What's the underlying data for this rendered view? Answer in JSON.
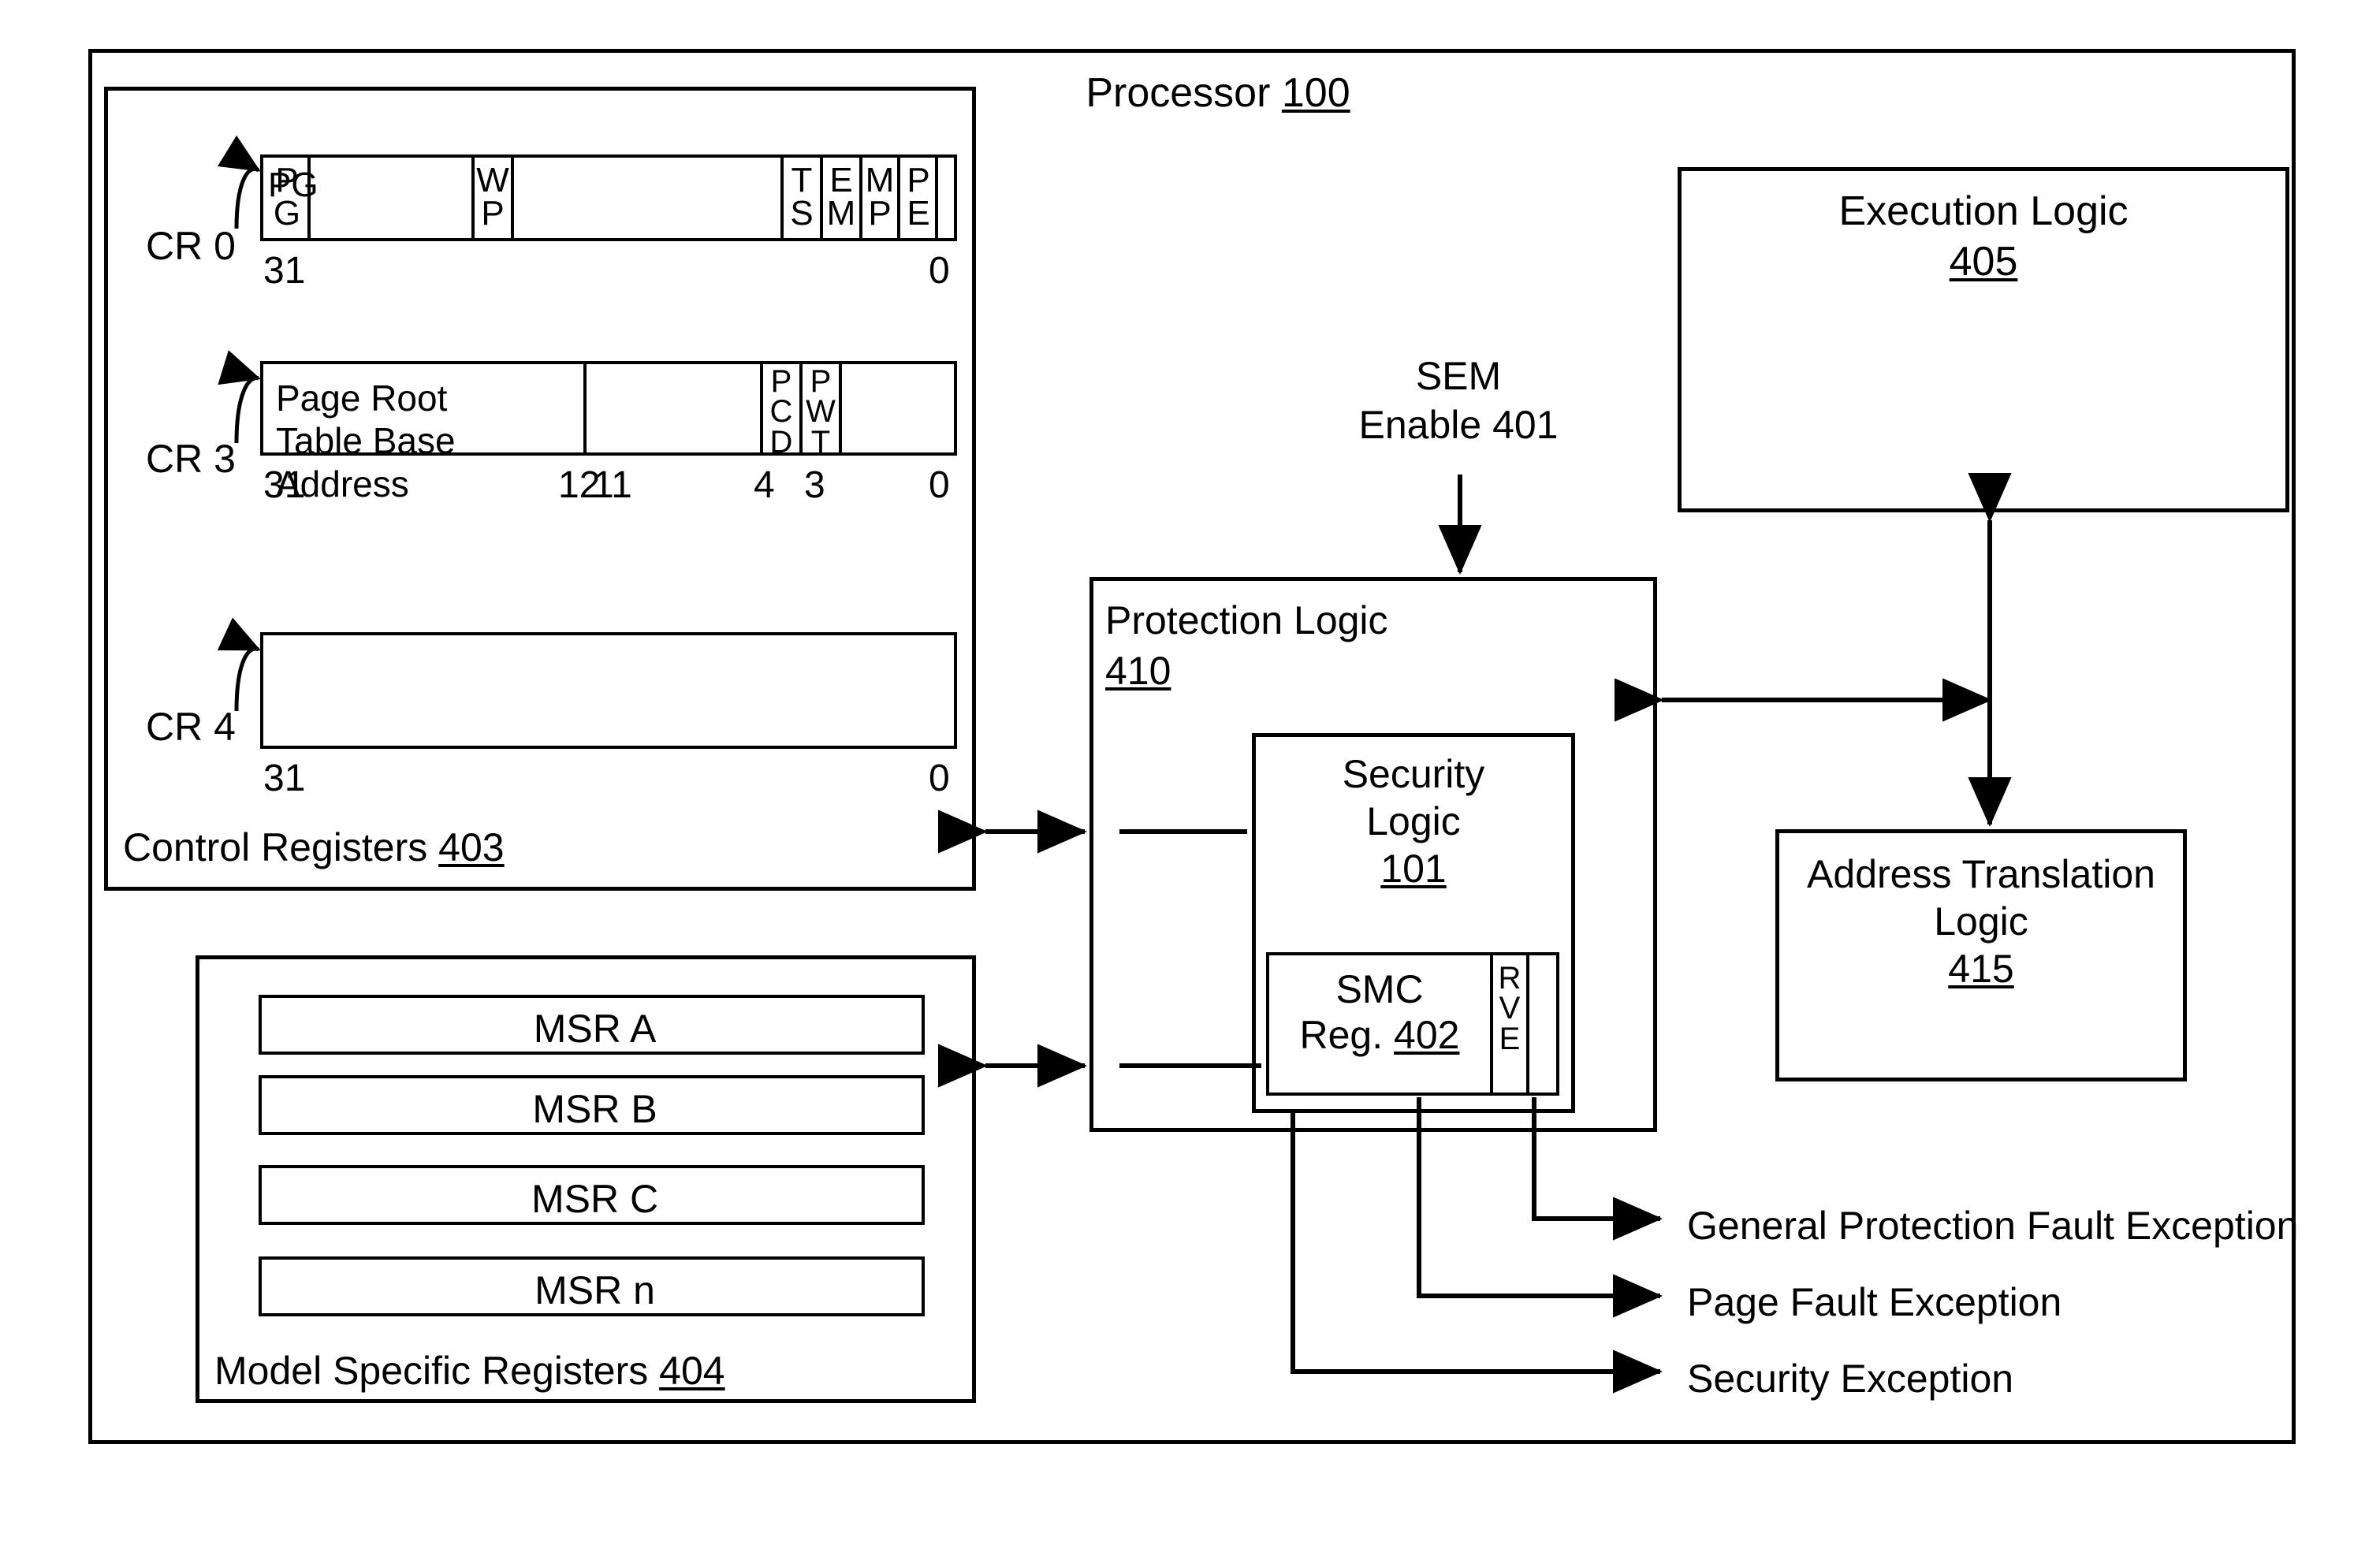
{
  "figure": {
    "processor": {
      "label": "Processor",
      "ref": "100"
    }
  },
  "control_registers": {
    "group_label": "Control Registers",
    "group_ref": "403",
    "registers": [
      {
        "name": "CR 0",
        "msb_label": "31",
        "lsb_label": "0",
        "fields": [
          "PG",
          "WP",
          "TS",
          "EM",
          "MP",
          "PE"
        ]
      },
      {
        "name": "CR 3",
        "msb_label": "31",
        "lsb_label": "0",
        "main_field": "Page Root Table Base Address",
        "bit_labels": [
          "12",
          "11",
          "4",
          "3",
          "0"
        ],
        "fields": [
          "PCD",
          "PWT"
        ]
      },
      {
        "name": "CR 4",
        "msb_label": "31",
        "lsb_label": "0",
        "fields": []
      }
    ]
  },
  "model_specific_registers": {
    "group_label": "Model Specific Registers",
    "group_ref": "404",
    "items": [
      "MSR A",
      "MSR B",
      "MSR C",
      "MSR n"
    ]
  },
  "sem_enable": {
    "line1": "SEM",
    "line2": "Enable 401"
  },
  "protection_logic": {
    "label": "Protection Logic",
    "ref": "410"
  },
  "security_logic": {
    "line1": "Security",
    "line2": "Logic",
    "ref": "101"
  },
  "smc_register": {
    "line1": "SMC",
    "line2_prefix": "Reg. ",
    "ref": "402",
    "bit_field": "RVE"
  },
  "execution_logic": {
    "label": "Execution Logic",
    "ref": "405"
  },
  "address_translation_logic": {
    "line1": "Address Translation",
    "line2": "Logic",
    "ref": "415"
  },
  "exceptions": [
    "General Protection Fault Exception",
    "Page Fault Exception",
    "Security Exception"
  ],
  "colors": {
    "ink": "#000000",
    "paper": "#ffffff"
  }
}
